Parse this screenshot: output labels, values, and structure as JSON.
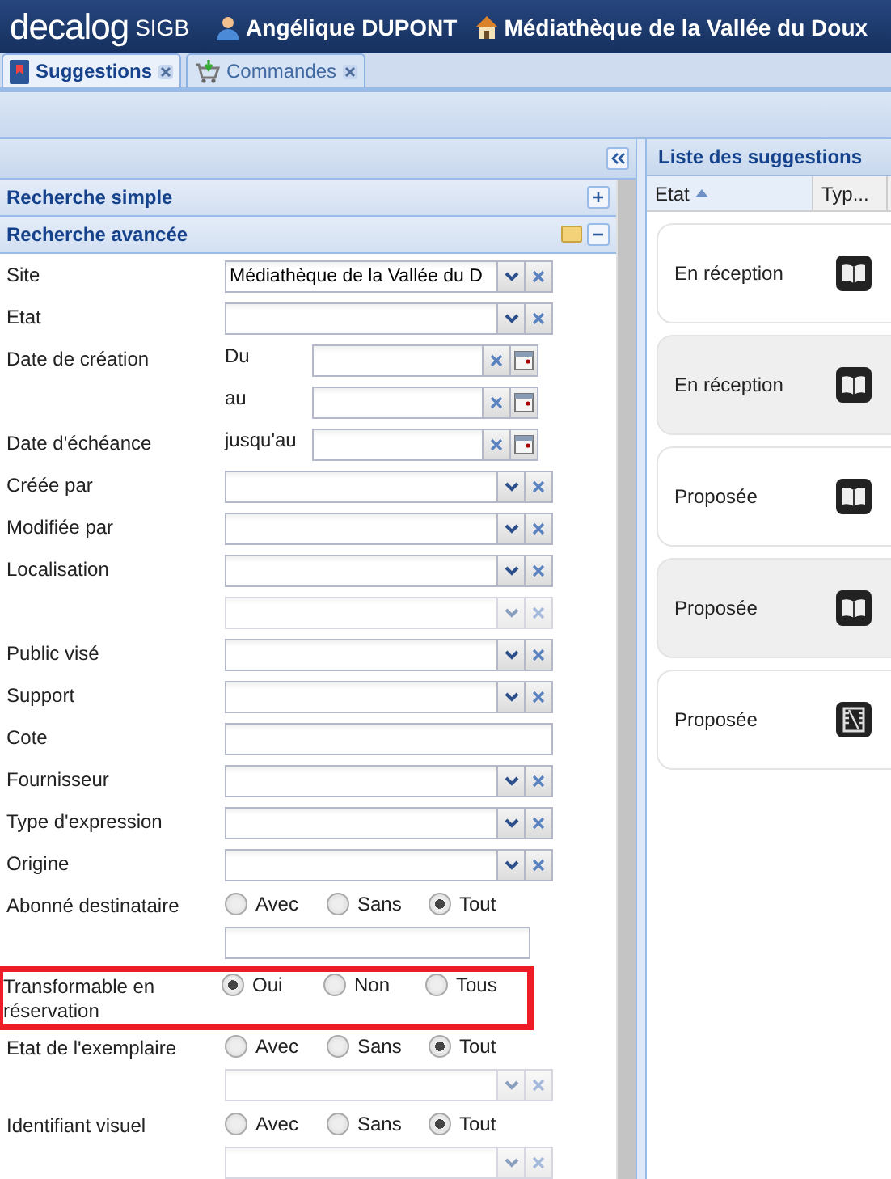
{
  "header": {
    "brand": "decalog",
    "product": "SIGB",
    "user": "Angélique DUPONT",
    "site": "Médiathèque de la Vallée du Doux"
  },
  "tabs": [
    {
      "label": "Suggestions",
      "selected": true
    },
    {
      "label": "Commandes",
      "selected": false
    }
  ],
  "search_panel": {
    "sections": [
      {
        "title": "Recherche simple",
        "expanded": false
      },
      {
        "title": "Recherche avancée",
        "expanded": true
      }
    ],
    "fields": [
      {
        "kind": "combo",
        "label": "Site",
        "value": "Médiathèque de la Vallée du D"
      },
      {
        "kind": "combo",
        "label": "Etat"
      },
      {
        "kind": "date",
        "label": "Date de création",
        "prefix": "Du"
      },
      {
        "kind": "date",
        "prefix": "au"
      },
      {
        "kind": "date",
        "label": "Date d'échéance",
        "prefix": "jusqu'au"
      },
      {
        "kind": "combo",
        "label": "Créée par"
      },
      {
        "kind": "combo",
        "label": "Modifiée par"
      },
      {
        "kind": "combo",
        "label": "Localisation"
      },
      {
        "kind": "combo",
        "disabled": true
      },
      {
        "kind": "combo",
        "label": "Public visé"
      },
      {
        "kind": "combo",
        "label": "Support"
      },
      {
        "kind": "text",
        "label": "Cote"
      },
      {
        "kind": "combo",
        "label": "Fournisseur"
      },
      {
        "kind": "combo",
        "label": "Type d'expression"
      },
      {
        "kind": "combo",
        "label": "Origine"
      },
      {
        "kind": "radio",
        "label": "Abonné destinataire",
        "options": [
          {
            "label": "Avec",
            "selected": false
          },
          {
            "label": "Sans",
            "selected": false
          },
          {
            "label": "Tout",
            "selected": true
          }
        ]
      },
      {
        "kind": "text"
      },
      {
        "kind": "radio",
        "label": "Transformable en réservation",
        "highlighted": true,
        "options": [
          {
            "label": "Oui",
            "selected": true
          },
          {
            "label": "Non",
            "selected": false
          },
          {
            "label": "Tous",
            "selected": false
          }
        ]
      },
      {
        "kind": "radio",
        "label": "Etat de l'exemplaire",
        "options": [
          {
            "label": "Avec",
            "selected": false
          },
          {
            "label": "Sans",
            "selected": false
          },
          {
            "label": "Tout",
            "selected": true
          }
        ]
      },
      {
        "kind": "combo",
        "disabled": true
      },
      {
        "kind": "radio",
        "label": "Identifiant visuel",
        "options": [
          {
            "label": "Avec",
            "selected": false
          },
          {
            "label": "Sans",
            "selected": false
          },
          {
            "label": "Tout",
            "selected": true
          }
        ]
      },
      {
        "kind": "combo",
        "disabled": true
      }
    ]
  },
  "results": {
    "title": "Liste des suggestions",
    "columns": [
      "Etat",
      "Typ..."
    ],
    "rows": [
      {
        "status": "En réception",
        "kind": "book"
      },
      {
        "status": "En réception",
        "kind": "book"
      },
      {
        "status": "Proposée",
        "kind": "book"
      },
      {
        "status": "Proposée",
        "kind": "book"
      },
      {
        "status": "Proposée",
        "kind": "film"
      }
    ]
  }
}
